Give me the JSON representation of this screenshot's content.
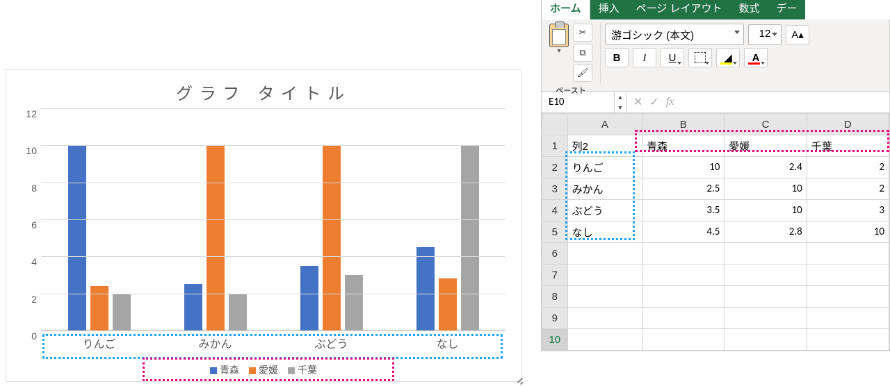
{
  "chart_data": {
    "type": "bar",
    "title": "グラフ タイトル",
    "categories": [
      "りんご",
      "みかん",
      "ぶどう",
      "なし"
    ],
    "series": [
      {
        "name": "青森",
        "color": "#4472C4",
        "values": [
          10,
          2.5,
          3.5,
          4.5
        ]
      },
      {
        "name": "愛媛",
        "color": "#ED7D31",
        "values": [
          2.4,
          10,
          10,
          2.8
        ]
      },
      {
        "name": "千葉",
        "color": "#A5A5A5",
        "values": [
          2,
          2,
          3,
          10
        ]
      }
    ],
    "ylim": [
      0,
      12
    ],
    "yticks": [
      0,
      2,
      4,
      6,
      8,
      10,
      12
    ],
    "xlabel": "",
    "ylabel": ""
  },
  "excel": {
    "tabs": [
      "ホーム",
      "挿入",
      "ページ レイアウト",
      "数式",
      "デー"
    ],
    "active_tab": "ホーム",
    "paste_label": "ペースト",
    "font_name": "游ゴシック (本文)",
    "font_size": "12",
    "bold": "B",
    "italic": "I",
    "underline": "U",
    "fill_color": "#FFFF00",
    "font_color": "#FF0000",
    "namebox": "E10",
    "fx_label": "fx",
    "table": {
      "col_headers": [
        "A",
        "B",
        "C",
        "D"
      ],
      "row_headers": [
        "1",
        "2",
        "3",
        "4",
        "5",
        "6",
        "7",
        "8",
        "9",
        "10"
      ],
      "rows": [
        [
          "列2",
          "青森",
          "愛媛",
          "千葉"
        ],
        [
          "りんご",
          "10",
          "2.4",
          "2"
        ],
        [
          "みかん",
          "2.5",
          "10",
          "2"
        ],
        [
          "ぶどう",
          "3.5",
          "10",
          "3"
        ],
        [
          "なし",
          "4.5",
          "2.8",
          "10"
        ],
        [
          "",
          "",
          "",
          ""
        ],
        [
          "",
          "",
          "",
          ""
        ],
        [
          "",
          "",
          "",
          ""
        ],
        [
          "",
          "",
          "",
          ""
        ],
        [
          "",
          "",
          "",
          ""
        ]
      ]
    }
  }
}
